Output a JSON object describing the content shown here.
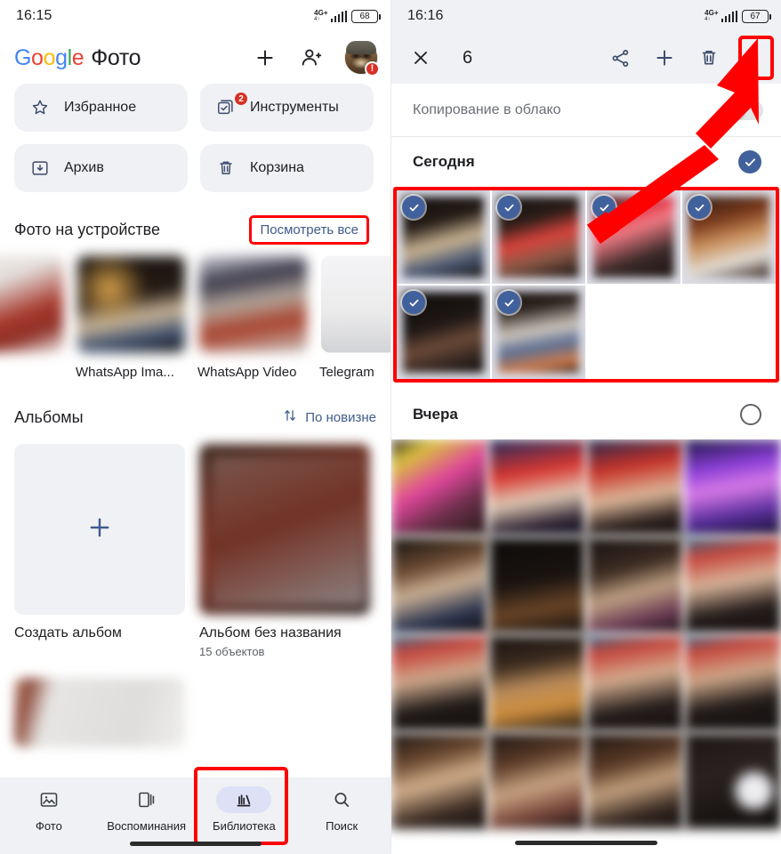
{
  "left": {
    "status": {
      "time": "16:15",
      "network": "4G+",
      "network_sub": "4↑",
      "battery": "68"
    },
    "appbar": {
      "brand_letters": [
        "G",
        "o",
        "o",
        "g",
        "l",
        "e"
      ],
      "brand_word": "Фото",
      "add_icon": "plus-icon",
      "sharing_icon": "people-icon",
      "avatar_icon": "avatar",
      "avatar_badge": "!"
    },
    "chips": [
      {
        "label": "Избранное",
        "icon": "star-icon",
        "badge": ""
      },
      {
        "label": "Инструменты",
        "icon": "tools-icon",
        "badge": "2"
      },
      {
        "label": "Архив",
        "icon": "archive-icon",
        "badge": ""
      },
      {
        "label": "Корзина",
        "icon": "trash-icon",
        "badge": ""
      }
    ],
    "device_section": {
      "title": "Фото на устройстве",
      "view_all": "Посмотреть все",
      "folders": [
        {
          "name": ""
        },
        {
          "name": "WhatsApp Ima..."
        },
        {
          "name": "WhatsApp Video"
        },
        {
          "name": "Telegram"
        }
      ]
    },
    "albums_section": {
      "title": "Альбомы",
      "sort_label": "По новизне",
      "sort_icon": "sort-icon",
      "create_label": "Создать альбом",
      "create_icon": "plus-icon",
      "album_name": "Альбом без названия",
      "album_count": "15 объектов"
    },
    "bottomnav": [
      {
        "label": "Фото",
        "icon": "photos-icon",
        "active": false
      },
      {
        "label": "Воспоминания",
        "icon": "memories-icon",
        "active": false
      },
      {
        "label": "Библиотека",
        "icon": "library-icon",
        "active": true
      },
      {
        "label": "Поиск",
        "icon": "search-icon",
        "active": false
      }
    ]
  },
  "right": {
    "status": {
      "time": "16:16",
      "network": "4G+",
      "network_sub": "4↑",
      "battery": "67"
    },
    "selbar": {
      "close_icon": "close-icon",
      "count": "6",
      "share_icon": "share-icon",
      "add_icon": "plus-icon",
      "delete_icon": "trash-icon",
      "more_icon": "more-vertical-icon"
    },
    "cloud_row": {
      "label": "Копирование в облако",
      "toggle_state": "off"
    },
    "today": {
      "title": "Сегодня",
      "selected": true,
      "selected_count": 6,
      "total_cells": 8
    },
    "yesterday": {
      "title": "Вчера",
      "selected": false,
      "visible_cells": 16
    }
  },
  "annotations": {
    "highlight_color": "#FF0000",
    "boxes": [
      "view-all-link",
      "library-tab",
      "more-menu-button",
      "today-photo-grid"
    ],
    "arrow": "points from today photo grid to more-menu-button"
  }
}
